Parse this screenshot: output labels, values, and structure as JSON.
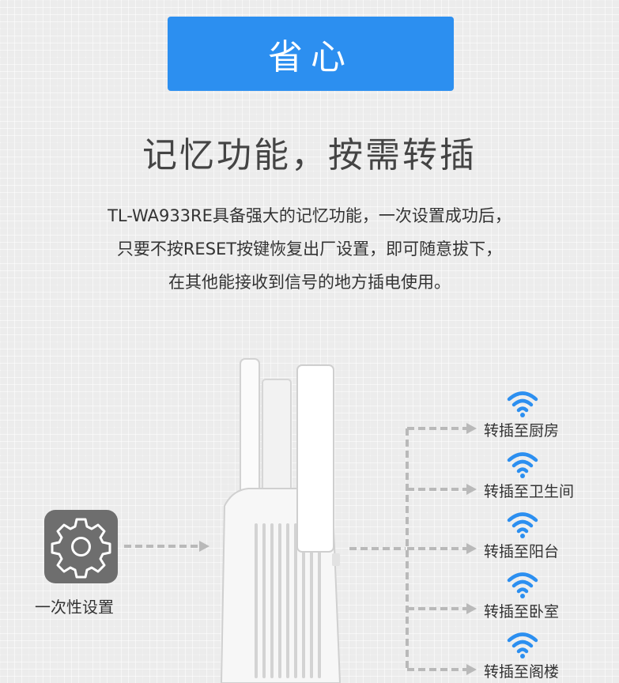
{
  "badge": {
    "label": "省心"
  },
  "headline": "记忆功能，按需转插",
  "description": {
    "line1": "TL-WA933RE具备强大的记忆功能，一次设置成功后，",
    "line2": "只要不按RESET按键恢复出厂设置，即可随意拔下，",
    "line3": "在其他能接收到信号的地方插电使用。"
  },
  "setup": {
    "label": "一次性设置",
    "icon": "gear-icon"
  },
  "destinations": [
    {
      "label": "转插至厨房",
      "icon": "wifi-icon"
    },
    {
      "label": "转插至卫生间",
      "icon": "wifi-icon"
    },
    {
      "label": "转插至阳台",
      "icon": "wifi-icon"
    },
    {
      "label": "转插至卧室",
      "icon": "wifi-icon"
    },
    {
      "label": "转插至阁楼",
      "icon": "wifi-icon"
    }
  ],
  "colors": {
    "accent": "#2c8ff0",
    "wifi": "#2c8ff0",
    "arrow": "#b9b9b9",
    "gear_bg": "#6e6e6e"
  }
}
